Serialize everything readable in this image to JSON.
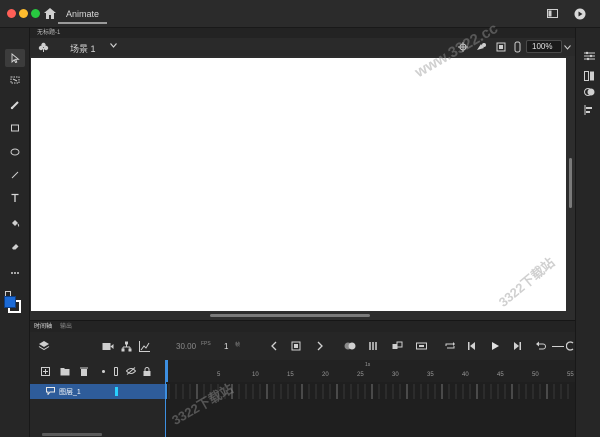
{
  "window": {
    "app_tab": "Animate"
  },
  "document": {
    "tab_label": "无标题-1"
  },
  "stage_header": {
    "scene_label": "场景 1",
    "zoom": "100%"
  },
  "timeline": {
    "tabs": [
      "时间轴",
      "输出"
    ],
    "fps": "30.00",
    "fps_unit": "FPS",
    "current_frame": "1",
    "frame_unit": "帧",
    "ruler_marker": "1s",
    "ruler_numbers": [
      "5",
      "10",
      "15",
      "20",
      "25",
      "30",
      "35",
      "40",
      "45",
      "50",
      "55"
    ],
    "layers": [
      {
        "name": "图层_1"
      }
    ]
  },
  "watermark": {
    "text_top": "www.3322.cc",
    "text_mid": "3322下载站",
    "text_bottom": "3322下载站"
  },
  "colors": {
    "accent": "#2e5c9a",
    "stroke_swatch": "#ffffff",
    "fill_swatch": "#1b6ad6",
    "keyframe_cursor": "#3d8fe0"
  }
}
